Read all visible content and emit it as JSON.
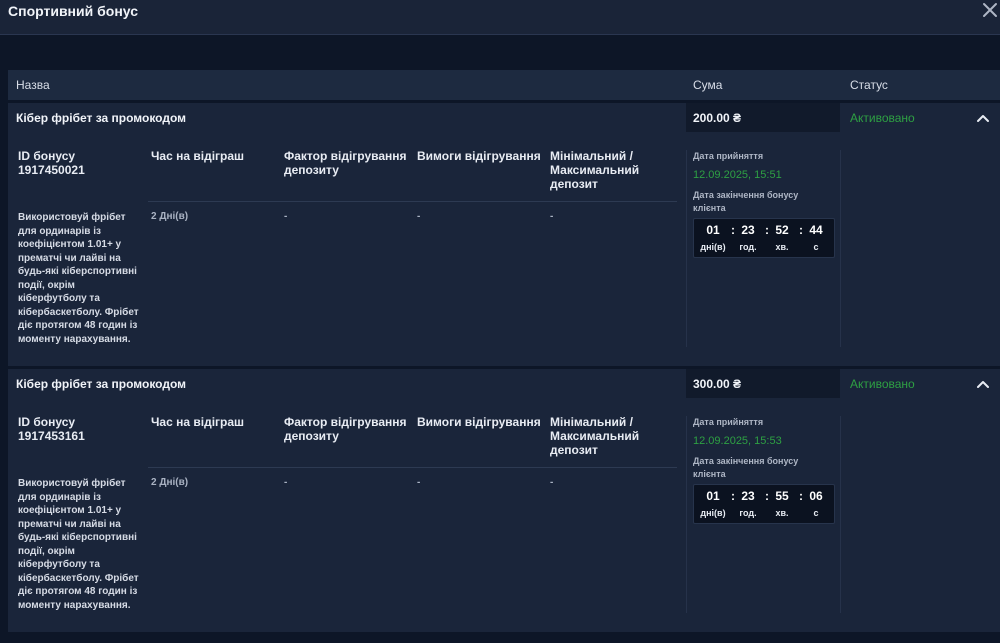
{
  "dialog": {
    "title": "Спортивний бонус",
    "close_icon": "close-icon"
  },
  "table": {
    "headers": {
      "name": "Назва",
      "sum": "Сума",
      "status": "Статус"
    }
  },
  "bonuses": [
    {
      "name": "Кібер фрібет за промокодом",
      "sum": "200.00 ₴",
      "status": "Активовано",
      "id_label": "ID бонусу 1917450021",
      "col_time": "Час на відіграш",
      "col_factor": "Фактор відігрування депозиту",
      "col_requirements": "Вимоги відігрування",
      "col_minmax": "Мінімальний / Максимальний депозит",
      "description": "Використовуй фрібет для ординарів із коефіцієнтом 1.01+ у прематчі чи лайві на будь-які кіберспортивні події, окрім кіберфутболу та кібербаскетболу. Фрібет діє протягом 48 годин із моменту нарахування.",
      "time_value": "2 Дні(в)",
      "factor_value": "-",
      "requirements_value": "-",
      "minmax_value": "-",
      "accepted_label": "Дата прийняття",
      "accepted_date": "12.09.2025, 15:51",
      "end_label": "Дата закінчення бонусу клієнта",
      "timer": {
        "days": "01",
        "hours": "23",
        "minutes": "52",
        "seconds": "44"
      },
      "timer_units": {
        "days": "дні(в)",
        "hours": "год.",
        "minutes": "хв.",
        "seconds": "с"
      }
    },
    {
      "name": "Кібер фрібет за промокодом",
      "sum": "300.00 ₴",
      "status": "Активовано",
      "id_label": "ID бонусу 1917453161",
      "col_time": "Час на відіграш",
      "col_factor": "Фактор відігрування депозиту",
      "col_requirements": "Вимоги відігрування",
      "col_minmax": "Мінімальний / Максимальний депозит",
      "description": "Використовуй фрібет для ординарів із коефіцієнтом 1.01+ у прематчі чи лайві на будь-які кіберспортивні події, окрім кіберфутболу та кібербаскетболу. Фрібет діє протягом 48 годин із моменту нарахування.",
      "time_value": "2 Дні(в)",
      "factor_value": "-",
      "requirements_value": "-",
      "minmax_value": "-",
      "accepted_label": "Дата прийняття",
      "accepted_date": "12.09.2025, 15:53",
      "end_label": "Дата закінчення бонусу клієнта",
      "timer": {
        "days": "01",
        "hours": "23",
        "minutes": "55",
        "seconds": "06"
      },
      "timer_units": {
        "days": "дні(в)",
        "hours": "год.",
        "minutes": "хв.",
        "seconds": "с"
      }
    }
  ],
  "colors": {
    "status_green": "#2ea043",
    "background": "#0d1627",
    "panel": "#1a253a"
  }
}
